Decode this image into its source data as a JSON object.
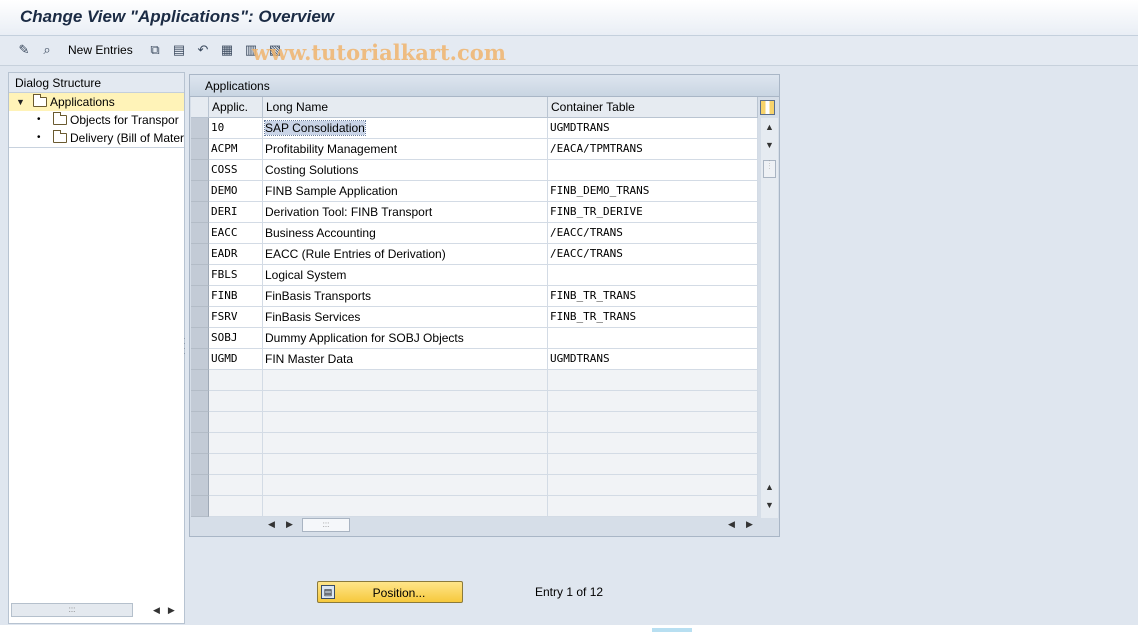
{
  "window": {
    "title": "Change View \"Applications\": Overview",
    "watermark": "www.tutorialkart.com"
  },
  "toolbar": {
    "new_entries_label": "New Entries",
    "icons": [
      "edit-pencil-icon",
      "display-icon",
      "copy-icon",
      "delete-icon",
      "undo-icon",
      "select-all-icon",
      "select-block-icon",
      "deselect-all-icon"
    ]
  },
  "dialog_structure": {
    "header": "Dialog Structure",
    "items": [
      {
        "label": "Applications",
        "level": 0,
        "expanded": true,
        "selected": true
      },
      {
        "label": "Objects for Transpor",
        "level": 1
      },
      {
        "label": "Delivery (Bill of Mater",
        "level": 1
      }
    ]
  },
  "table": {
    "title": "Applications",
    "columns": [
      "Applic.",
      "Long Name",
      "Container Table"
    ],
    "rows": [
      {
        "applic": "10",
        "long_name": "SAP Consolidation",
        "container": "UGMDTRANS"
      },
      {
        "applic": "ACPM",
        "long_name": "Profitability Management",
        "container": "/EACA/TPMTRANS"
      },
      {
        "applic": "COSS",
        "long_name": "Costing Solutions",
        "container": ""
      },
      {
        "applic": "DEMO",
        "long_name": "FINB Sample Application",
        "container": "FINB_DEMO_TRANS"
      },
      {
        "applic": "DERI",
        "long_name": "Derivation Tool: FINB Transport",
        "container": "FINB_TR_DERIVE"
      },
      {
        "applic": "EACC",
        "long_name": "Business Accounting",
        "container": "/EACC/TRANS"
      },
      {
        "applic": "EADR",
        "long_name": "EACC (Rule Entries of Derivation)",
        "container": "/EACC/TRANS"
      },
      {
        "applic": "FBLS",
        "long_name": "Logical System",
        "container": ""
      },
      {
        "applic": "FINB",
        "long_name": "FinBasis Transports",
        "container": "FINB_TR_TRANS"
      },
      {
        "applic": "FSRV",
        "long_name": "FinBasis Services",
        "container": "FINB_TR_TRANS"
      },
      {
        "applic": "SOBJ",
        "long_name": "Dummy Application for SOBJ Objects",
        "container": ""
      },
      {
        "applic": "UGMD",
        "long_name": "FIN Master Data",
        "container": "UGMDTRANS"
      }
    ],
    "empty_rows": 7,
    "highlighted_cell": "SAP Consolidation"
  },
  "footer": {
    "position_button": "Position...",
    "entry_info": "Entry 1 of 12"
  }
}
